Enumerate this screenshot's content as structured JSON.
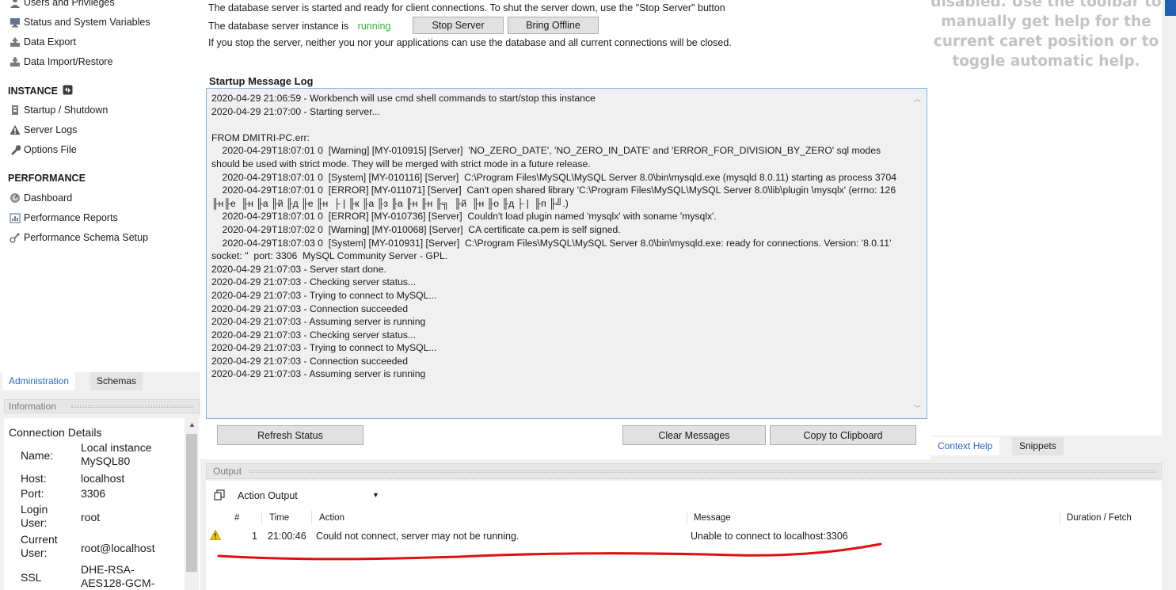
{
  "navigator": {
    "management_items": [
      {
        "label": "Users and Privileges",
        "icon": "users-icon"
      },
      {
        "label": "Status and System Variables",
        "icon": "monitor-icon"
      },
      {
        "label": "Data Export",
        "icon": "export-icon"
      },
      {
        "label": "Data Import/Restore",
        "icon": "import-icon"
      }
    ],
    "instance_heading": "INSTANCE",
    "instance_items": [
      {
        "label": "Startup / Shutdown",
        "icon": "power-icon"
      },
      {
        "label": "Server Logs",
        "icon": "warning-icon"
      },
      {
        "label": "Options File",
        "icon": "wrench-icon"
      }
    ],
    "performance_heading": "PERFORMANCE",
    "performance_items": [
      {
        "label": "Dashboard",
        "icon": "dashboard-icon"
      },
      {
        "label": "Performance Reports",
        "icon": "reports-icon"
      },
      {
        "label": "Performance Schema Setup",
        "icon": "setup-icon"
      }
    ]
  },
  "left_tabs": {
    "administration": "Administration",
    "schemas": "Schemas"
  },
  "information": {
    "header": "Information",
    "title": "Connection Details",
    "rows": [
      {
        "label": "Name:",
        "value": "Local instance\nMySQL80"
      },
      {
        "label": "Host:",
        "value": "localhost"
      },
      {
        "label": "Port:",
        "value": "3306"
      },
      {
        "label": "Login\nUser:",
        "value": "root"
      },
      {
        "label": "Current\nUser:",
        "value": "root@localhost"
      },
      {
        "label": "SSL",
        "value": "DHE-RSA-\nAES128-GCM-"
      }
    ]
  },
  "server_status": {
    "line1": "The database server is started and ready for client connections. To shut the server down, use the \"Stop Server\" button",
    "line2_prefix": "The database server instance is",
    "status": "running",
    "stop_button": "Stop Server",
    "offline_button": "Bring Offline",
    "line3": "If you stop the server, neither you nor your applications can use the database and all current connections will be closed."
  },
  "startup_log": {
    "title": "Startup Message Log",
    "lines": [
      "2020-04-29 21:06:59 - Workbench will use cmd shell commands to start/stop this instance",
      "2020-04-29 21:07:00 - Starting server...",
      "",
      "FROM DMITRI-PC.err:",
      "    2020-04-29T18:07:01 0  [Warning] [MY-010915] [Server]  'NO_ZERO_DATE', 'NO_ZERO_IN_DATE' and 'ERROR_FOR_DIVISION_BY_ZERO' sql modes should be used with strict mode. They will be merged with strict mode in a future release.",
      "    2020-04-29T18:07:01 0  [System] [MY-010116] [Server]  C:\\Program Files\\MySQL\\MySQL Server 8.0\\bin\\mysqld.exe (mysqld 8.0.11) starting as process 3704",
      "    2020-04-29T18:07:01 0  [ERROR] [MY-011071] [Server]  Can't open shared library 'C:\\Program Files\\MySQL\\MySQL Server 8.0\\lib\\plugin \\mysqlx' (errno: 126  ╟н╟е  ╟н ╟а ╟й ╟д ╟е ╟н  ├ | ╟к ╟а ╟з ╟а ╟н ╟н ╟╗  ╟й  ╟н ╟о ╟д ├ |  ╟п ╟╝.)",
      "    2020-04-29T18:07:01 0  [ERROR] [MY-010736] [Server]  Couldn't load plugin named 'mysqlx' with soname 'mysqlx'.",
      "    2020-04-29T18:07:02 0  [Warning] [MY-010068] [Server]  CA certificate ca.pem is self signed.",
      "    2020-04-29T18:07:03 0  [System] [MY-010931] [Server]  C:\\Program Files\\MySQL\\MySQL Server 8.0\\bin\\mysqld.exe: ready for connections. Version: '8.0.11'  socket: ''  port: 3306  MySQL Community Server - GPL.",
      "2020-04-29 21:07:03 - Server start done.",
      "2020-04-29 21:07:03 - Checking server status...",
      "2020-04-29 21:07:03 - Trying to connect to MySQL...",
      "2020-04-29 21:07:03 - Connection succeeded",
      "2020-04-29 21:07:03 - Assuming server is running",
      "2020-04-29 21:07:03 - Checking server status...",
      "2020-04-29 21:07:03 - Trying to connect to MySQL...",
      "2020-04-29 21:07:03 - Connection succeeded",
      "2020-04-29 21:07:03 - Assuming server is running"
    ]
  },
  "log_buttons": {
    "refresh": "Refresh Status",
    "clear": "Clear Messages",
    "copy": "Copy to Clipboard"
  },
  "help_panel": {
    "text": "disabled. Use the toolbar to\nmanually get help for the\ncurrent caret position or to\ntoggle automatic help."
  },
  "right_tabs": {
    "context_help": "Context Help",
    "snippets": "Snippets"
  },
  "output": {
    "header": "Output",
    "dropdown": "Action Output",
    "columns": {
      "num": "#",
      "time": "Time",
      "action": "Action",
      "message": "Message",
      "duration": "Duration / Fetch"
    },
    "rows": [
      {
        "num": "1",
        "time": "21:00:46",
        "action": "Could not connect, server may not be running.",
        "message": "Unable to connect to localhost:3306",
        "duration": "",
        "icon": "warning-icon"
      }
    ]
  },
  "colors": {
    "accent": "#2a6bbf",
    "running": "#33b233",
    "annotation": "#e01010",
    "warning": "#f2c200"
  }
}
